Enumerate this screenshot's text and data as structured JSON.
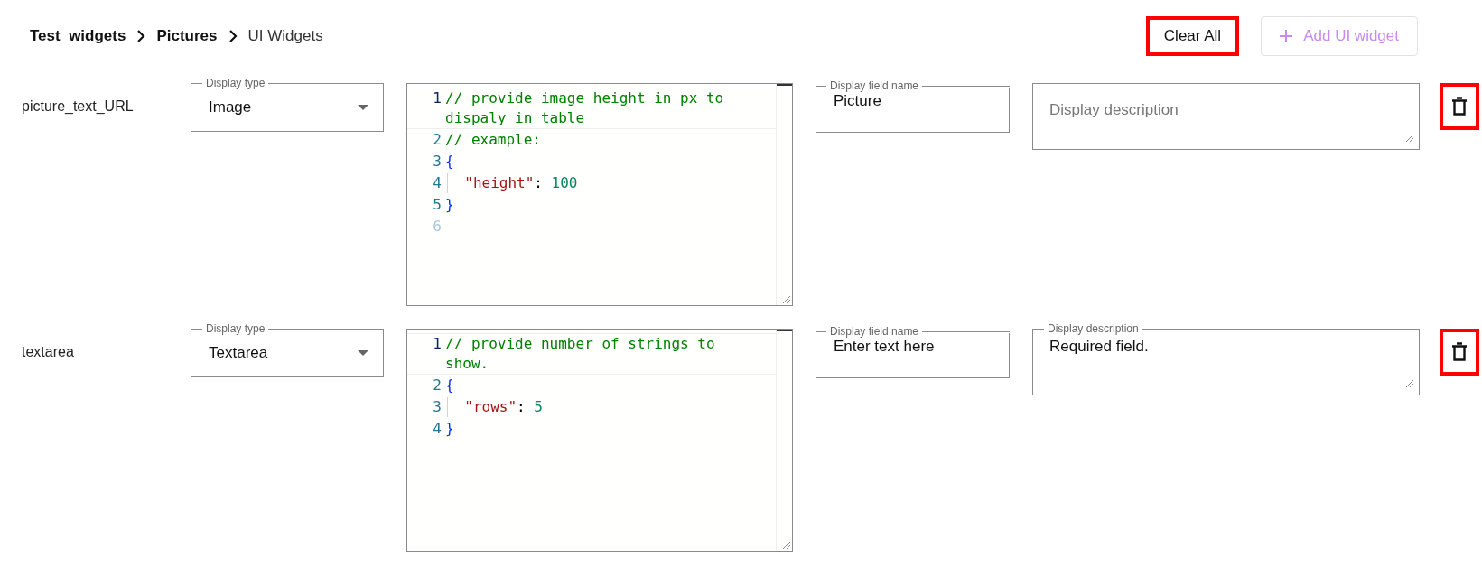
{
  "breadcrumb": [
    {
      "label": "Test_widgets",
      "current": false
    },
    {
      "label": "Pictures",
      "current": false
    },
    {
      "label": "UI Widgets",
      "current": true
    }
  ],
  "actions": [
    {
      "label": "Clear All",
      "kind": "clear",
      "highlighted": true,
      "disabled": false
    },
    {
      "label": "Add UI widget",
      "kind": "add",
      "highlighted": false,
      "disabled": true
    }
  ],
  "widgets": [
    {
      "name": "picture_text_URL",
      "display_type": {
        "label": "Display type",
        "value": "Image"
      },
      "code": [
        {
          "number": "1",
          "active": true,
          "faint": false,
          "indent": false,
          "tokens": [
            {
              "kind": "comment",
              "text": "// provide image height in px to dispaly in table"
            }
          ]
        },
        {
          "number": "2",
          "active": false,
          "faint": false,
          "indent": false,
          "tokens": [
            {
              "kind": "comment",
              "text": "// example:"
            }
          ]
        },
        {
          "number": "3",
          "active": false,
          "faint": false,
          "indent": false,
          "tokens": [
            {
              "kind": "brace",
              "text": "{"
            }
          ]
        },
        {
          "number": "4",
          "active": false,
          "faint": false,
          "indent": true,
          "tokens": [
            {
              "kind": "key",
              "text": "\"height\""
            },
            {
              "kind": "punct",
              "text": ": "
            },
            {
              "kind": "number",
              "text": "100"
            }
          ]
        },
        {
          "number": "5",
          "active": false,
          "faint": false,
          "indent": false,
          "tokens": [
            {
              "kind": "brace",
              "text": "}"
            }
          ]
        },
        {
          "number": "6",
          "active": false,
          "faint": true
        }
      ],
      "field_name": {
        "label": "Display field name",
        "value": "Picture"
      },
      "description": {
        "placeholder": "Display description"
      },
      "delete_highlighted": true
    },
    {
      "name": "textarea",
      "display_type": {
        "label": "Display type",
        "value": "Textarea"
      },
      "code": [
        {
          "number": "1",
          "active": true,
          "faint": false,
          "indent": false,
          "tokens": [
            {
              "kind": "comment",
              "text": "// provide number of strings to show."
            }
          ]
        },
        {
          "number": "2",
          "active": false,
          "faint": false,
          "indent": false,
          "tokens": [
            {
              "kind": "brace",
              "text": "{"
            }
          ]
        },
        {
          "number": "3",
          "active": false,
          "faint": false,
          "indent": true,
          "tokens": [
            {
              "kind": "key",
              "text": "\"rows\""
            },
            {
              "kind": "punct",
              "text": ": "
            },
            {
              "kind": "number",
              "text": "5"
            }
          ]
        },
        {
          "number": "4",
          "active": false,
          "faint": false,
          "indent": false,
          "tokens": [
            {
              "kind": "brace",
              "text": "}"
            }
          ]
        }
      ],
      "field_name": {
        "label": "Display field name",
        "value": "Enter text here"
      },
      "description": {
        "label": "Display description",
        "value": "Required field."
      },
      "delete_highlighted": true
    }
  ]
}
